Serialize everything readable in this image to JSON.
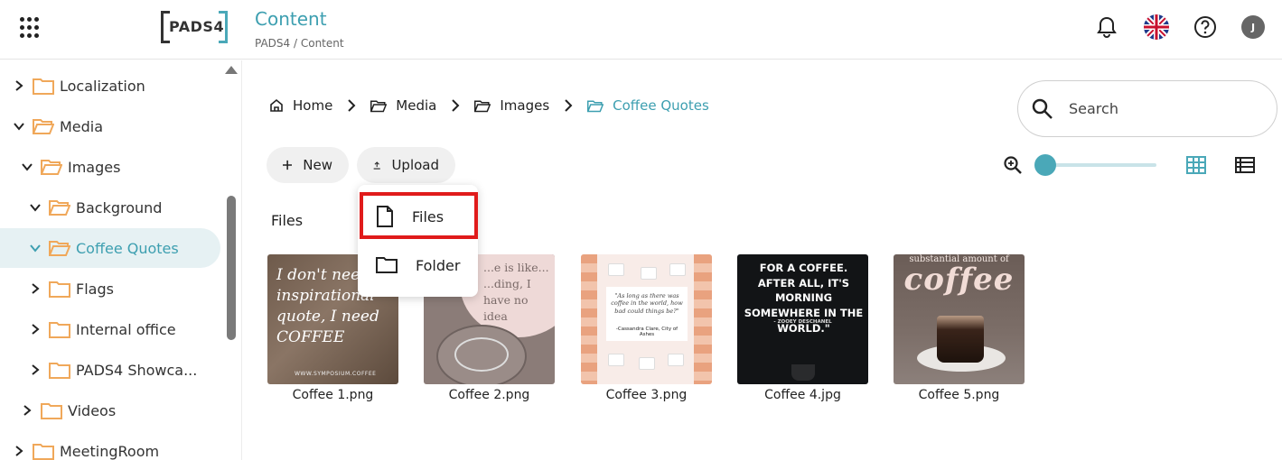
{
  "header": {
    "logo_text": "PADS4",
    "page_title": "Content",
    "breadcrumb": "PADS4  /  Content",
    "avatar_initial": "J"
  },
  "sidebar": {
    "items": [
      {
        "label": "Localization",
        "state": "collapsed"
      },
      {
        "label": "Media",
        "state": "expanded"
      },
      {
        "label": "Images",
        "state": "expanded"
      },
      {
        "label": "Background",
        "state": "expanded"
      },
      {
        "label": "Coffee Quotes",
        "state": "expanded",
        "selected": true
      },
      {
        "label": "Flags",
        "state": "collapsed"
      },
      {
        "label": "Internal office",
        "state": "collapsed"
      },
      {
        "label": "PADS4 Showca...",
        "state": "collapsed"
      },
      {
        "label": "Videos",
        "state": "collapsed"
      },
      {
        "label": "MeetingRoom",
        "state": "collapsed"
      }
    ]
  },
  "breadcrumb": {
    "home": "Home",
    "media": "Media",
    "images": "Images",
    "current": "Coffee Quotes"
  },
  "search": {
    "placeholder": "Search"
  },
  "toolbar": {
    "new_label": "New",
    "upload_label": "Upload"
  },
  "upload_menu": {
    "files_label": "Files",
    "folder_label": "Folder"
  },
  "files": {
    "section_label": "Files",
    "items": [
      {
        "name": "Coffee 1.png",
        "preview_text": "I don't need inspirational quote, I need COFFEE",
        "preview_footer": "WWW.SYMPOSIUM.COFFEE"
      },
      {
        "name": "Coffee 2.png",
        "preview_text": "...e is like... ...ding, I have no idea"
      },
      {
        "name": "Coffee 3.png",
        "preview_text": "\"As long as there was coffee in the world, how bad could things be?\"",
        "preview_footer": "-Cassandra Clare, City of Ashes"
      },
      {
        "name": "Coffee 4.jpg",
        "preview_text": "FOR A COFFEE. AFTER ALL, IT'S MORNING SOMEWHERE IN THE WORLD.\"",
        "preview_footer": "- ZOOEY DESCHANEL"
      },
      {
        "name": "Coffee 5.png",
        "preview_text": "substantial amount of",
        "preview_big": "coffee"
      }
    ]
  },
  "colors": {
    "accent": "#3d9fb0",
    "highlight": "#e01b1b",
    "folder": "#f0a85a"
  }
}
